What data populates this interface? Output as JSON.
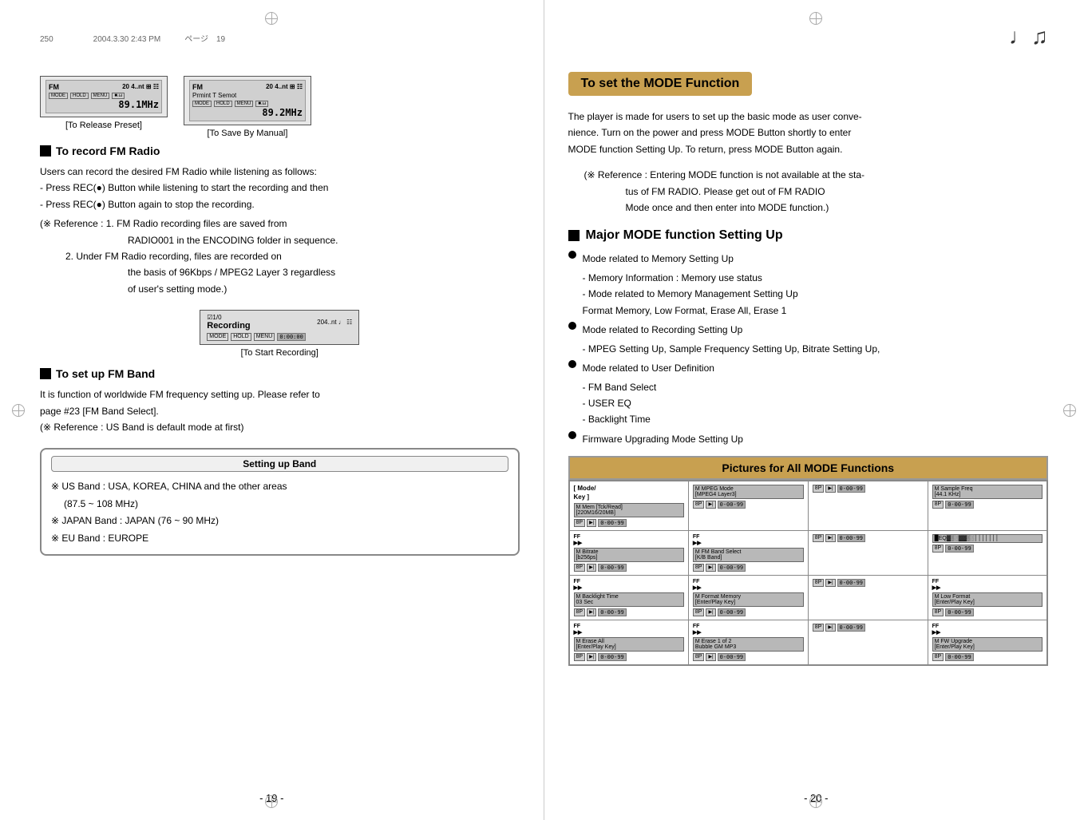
{
  "left": {
    "header": "250　　　　　2004.3.30 2:43 PM　　　ページ　19",
    "fm_radio_title": "To record FM Radio",
    "fm_radio_body_1": "Users can record the desired FM Radio while listening as follows:",
    "fm_radio_body_2": "- Press REC(●) Button while listening to start the recording and then",
    "fm_radio_body_3": "- Press REC(●) Button again to stop the recording.",
    "fm_radio_reference": "(※ Reference : 1. FM  Radio  recording  files  are  saved  from               RADIO001 in the ENCODING folder in sequence.",
    "fm_radio_reference_2": "2. Under  FM  Radio  recording,  files  are  recorded  on               the basis of 96Kbps / MPEG2 Layer 3 regardless               of user's setting mode.)",
    "recording_label": "[To Start Recording]",
    "fm_band_title": "To set up FM Band",
    "fm_band_body_1": "It is function of worldwide FM frequency setting up. Please refer to",
    "fm_band_body_2": "page #23 [FM Band Select].",
    "fm_band_reference": "(※ Reference : US Band is default mode at first)",
    "setting_band_box_title": "Setting up Band",
    "setting_band_1": "※ US Band : USA, KOREA, CHINA and the other areas",
    "setting_band_2": "(87.5 ~ 108 MHz)",
    "setting_band_3": "※ JAPAN Band : JAPAN (76 ~ 90 MHz)",
    "setting_band_4": "※ EU Band : EUROPE",
    "to_release_preset": "[To Release Preset]",
    "to_save_manual": "[To Save By Manual]",
    "page_number": "- 19 -",
    "fm1_top_left": "FM",
    "fm1_top_right": "20 4..s",
    "fm1_freq": "89.1MHz",
    "fm2_top_left": "FM",
    "fm2_top_right": "20 4..s",
    "fm2_freq": "89.2MHz"
  },
  "right": {
    "mode_title": "To set the MODE Function",
    "mode_body_1": "The player is made for users to set up the basic mode as user conve-",
    "mode_body_2": "nience. Turn on the power and press MODE Button shortly to enter",
    "mode_body_3": "MODE function Setting Up. To return, press MODE Button again.",
    "mode_ref_1": "(※  Reference : Entering MODE function is not available at the sta-",
    "mode_ref_2": "tus of FM RADIO. Please get out of FM RADIO",
    "mode_ref_3": "Mode once and then enter into MODE function.)",
    "major_mode_title": "Major MODE function Setting Up",
    "bullet1_main": "Mode related to Memory Setting Up",
    "bullet1_sub1": "- Memory Information : Memory use status",
    "bullet1_sub2": "- Mode related to Memory Management Setting Up",
    "bullet1_sub3": "Format Memory, Low Format, Erase All, Erase 1",
    "bullet2_main": "Mode related to Recording Setting Up",
    "bullet2_sub1": "- MPEG Setting Up, Sample Frequency Setting Up, Bitrate Setting Up,",
    "bullet3_main": "Mode related to User Definition",
    "bullet3_sub1": "- FM Band Select",
    "bullet3_sub2": "- USER EQ",
    "bullet3_sub3": "- Backlight Time",
    "bullet4_main": "Firmware Upgrading Mode Setting Up",
    "pictures_title": "Pictures for All MODE Functions",
    "page_number": "- 20 -",
    "table": [
      [
        {
          "label": "[ Mode/\n Key ]",
          "screen": "M Mem [Tck/Read]\nR220M16/20MB]",
          "btns": [
            "8P",
            "FF"
          ],
          "seg": "0-00-99"
        },
        {
          "label": "",
          "screen": "M MPEG Mode\n[MPEG4 Layer3]",
          "btns": [
            "8P",
            "FF"
          ],
          "seg": "0-00-99"
        },
        {
          "label": "",
          "screen": "",
          "btns": [
            "8P",
            "FF"
          ],
          "seg": "0-00-99"
        },
        {
          "label": "",
          "screen": "M Sample Freq\n[44.1 KHz]",
          "btns": [
            "8P"
          ],
          "seg": "0-00-99"
        }
      ],
      [
        {
          "label": "FF",
          "screen": "M Bitrate\n[b256ps]",
          "btns": [
            "8P",
            "FF"
          ],
          "seg": "0-00-99"
        },
        {
          "label": "FF",
          "screen": "M FM Band Select\n[K/B Band]",
          "btns": [
            "8P",
            "FF"
          ],
          "seg": "0-00-99"
        },
        {
          "label": "",
          "screen": "",
          "btns": [
            "8P",
            "FF"
          ],
          "seg": "0-00-99"
        },
        {
          "label": "",
          "screen": "",
          "btns": [
            "8P"
          ],
          "seg": "0-00-99"
        }
      ],
      [
        {
          "label": "FF",
          "screen": "M Backlight Time\n03 Sec",
          "btns": [
            "8P",
            "FF"
          ],
          "seg": "0-00-99"
        },
        {
          "label": "FF",
          "screen": "M Format Memory\n[Enter/Play Key]",
          "btns": [
            "8P",
            "FF"
          ],
          "seg": "0-00-99"
        },
        {
          "label": "",
          "screen": "",
          "btns": [
            "8P",
            "FF"
          ],
          "seg": "0-00-99"
        },
        {
          "label": "FF",
          "screen": "M Low Format\n[Enter/Play Key]",
          "btns": [
            "8P"
          ],
          "seg": "0-00-99"
        }
      ],
      [
        {
          "label": "FF",
          "screen": "M Erase All\n[Enter/Play Key]",
          "btns": [
            "8P",
            "FF"
          ],
          "seg": "0-00-99"
        },
        {
          "label": "FF",
          "screen": "M Erase 1 of 2\nBubble GM MP3",
          "btns": [
            "8P",
            "FF"
          ],
          "seg": "0-00-99"
        },
        {
          "label": "",
          "screen": "",
          "btns": [
            "8P",
            "FF"
          ],
          "seg": "0-00-99"
        },
        {
          "label": "FF",
          "screen": "M FW Upgrade\n[Enter/Play Key]",
          "btns": [
            "8P"
          ],
          "seg": "0-00-99"
        }
      ]
    ]
  }
}
